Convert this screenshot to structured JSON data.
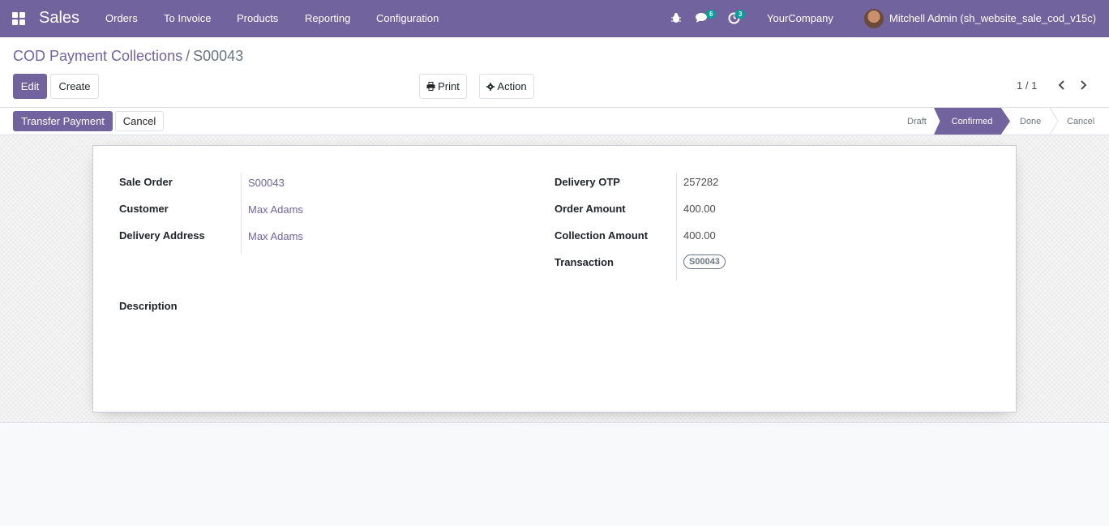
{
  "navbar": {
    "app_name": "Sales",
    "menu": [
      "Orders",
      "To Invoice",
      "Products",
      "Reporting",
      "Configuration"
    ],
    "messages_badge": "6",
    "activities_badge": "3",
    "company": "YourCompany",
    "user": "Mitchell Admin (sh_website_sale_cod_v15c)"
  },
  "breadcrumb": {
    "parent": "COD Payment Collections",
    "separator": "/",
    "current": "S00043"
  },
  "actions": {
    "edit": "Edit",
    "create": "Create",
    "print": "Print",
    "action": "Action"
  },
  "pager": {
    "value": "1 / 1"
  },
  "statusbar": {
    "buttons": {
      "transfer_payment": "Transfer Payment",
      "cancel": "Cancel"
    },
    "stages": [
      "Draft",
      "Confirmed",
      "Done",
      "Cancel"
    ],
    "active_stage": "Confirmed"
  },
  "form": {
    "left": {
      "sale_order_label": "Sale Order",
      "sale_order_value": "S00043",
      "customer_label": "Customer",
      "customer_value": "Max Adams",
      "delivery_address_label": "Delivery Address",
      "delivery_address_value": "Max Adams"
    },
    "right": {
      "delivery_otp_label": "Delivery OTP",
      "delivery_otp_value": "257282",
      "order_amount_label": "Order Amount",
      "order_amount_value": "400.00",
      "collection_amount_label": "Collection Amount",
      "collection_amount_value": "400.00",
      "transaction_label": "Transaction",
      "transaction_tag": "S00043"
    },
    "description_label": "Description"
  },
  "colors": {
    "brand": "#71639e",
    "badge": "#00a09d"
  }
}
